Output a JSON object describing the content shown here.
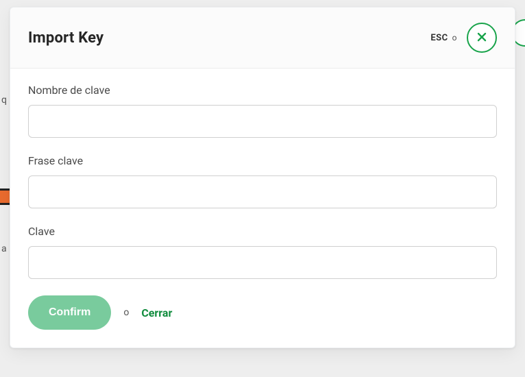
{
  "bg": {
    "q_char": "q",
    "a_char": "a"
  },
  "modal": {
    "title": "Import Key",
    "esc_label": "ESC",
    "esc_or": "o",
    "close_icon": "close-icon",
    "fields": {
      "key_name": {
        "label": "Nombre de clave",
        "value": ""
      },
      "passphrase": {
        "label": "Frase clave",
        "value": ""
      },
      "key": {
        "label": "Clave",
        "value": ""
      }
    },
    "actions": {
      "confirm": "Confirm",
      "or": "o",
      "close": "Cerrar"
    }
  }
}
